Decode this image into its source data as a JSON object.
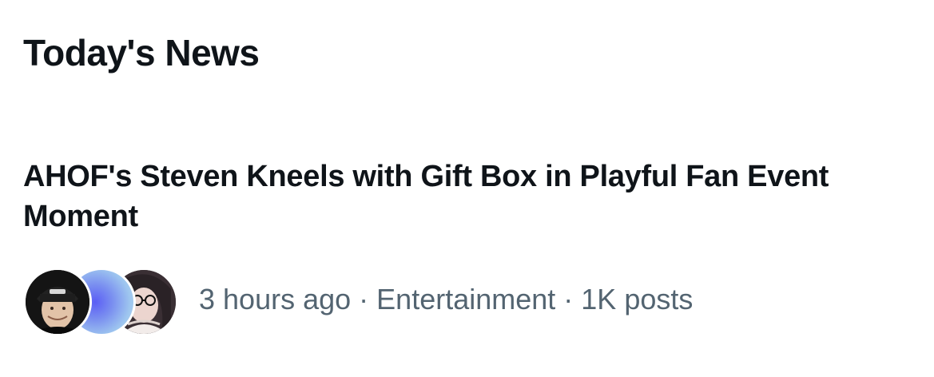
{
  "section": {
    "title": "Today's News"
  },
  "news_item": {
    "headline": "AHOF's Steven Kneels with Gift Box in Playful Fan Event Moment",
    "time_ago": "3 hours ago",
    "separator": " · ",
    "category": "Entertainment",
    "post_count": "1K posts",
    "avatars": [
      {
        "name": "avatar-photo-person-cap"
      },
      {
        "name": "avatar-gradient-blue"
      },
      {
        "name": "avatar-photo-person-glasses"
      }
    ]
  },
  "colors": {
    "text_primary": "#0f1419",
    "text_secondary": "#536471",
    "background": "#ffffff"
  }
}
